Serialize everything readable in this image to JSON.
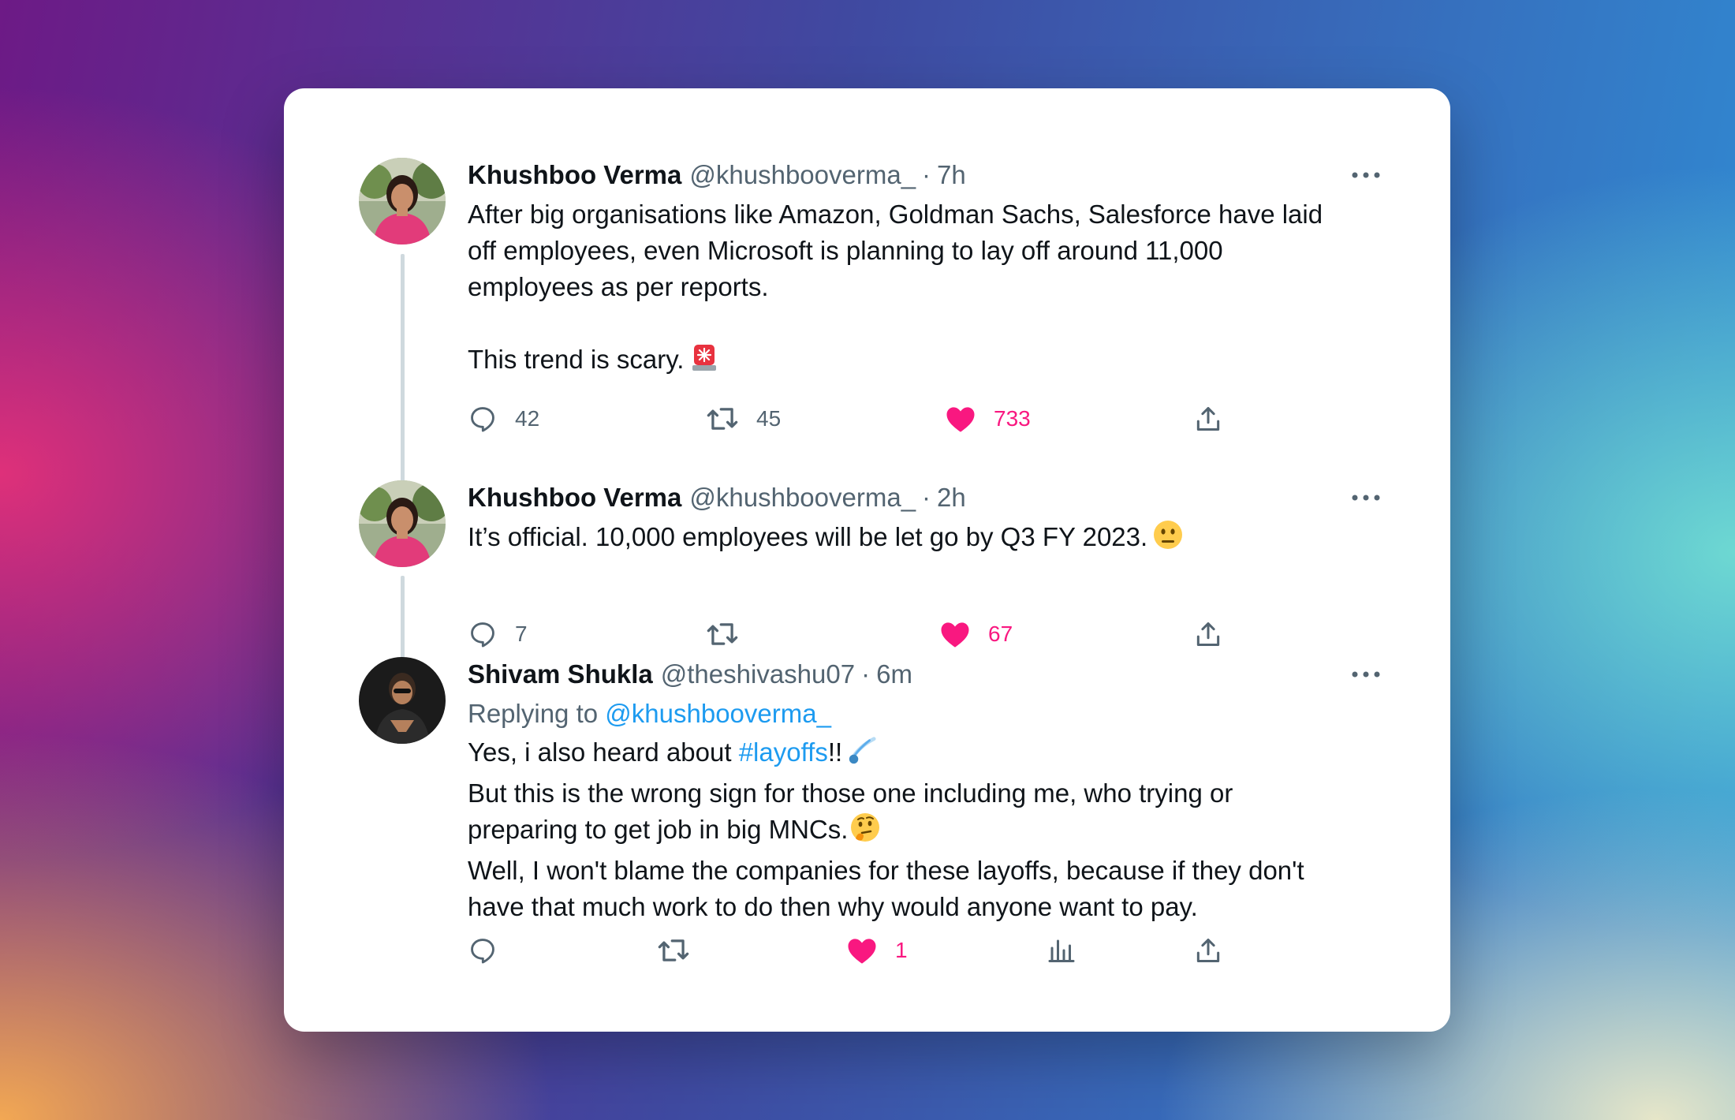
{
  "tweets": [
    {
      "name": "Khushboo Verma",
      "handle": "@khushbooverma_",
      "separator": "·",
      "time": "7h",
      "text_lines": [
        "After big organisations like Amazon, Goldman Sachs, Salesforce have laid",
        "off employees, even Microsoft is planning to lay off around 11,000",
        "employees as per reports."
      ],
      "text_line2": "This trend is scary.",
      "emoji": "police-light",
      "replies": "42",
      "retweets": "45",
      "likes": "733"
    },
    {
      "name": "Khushboo Verma",
      "handle": "@khushbooverma_",
      "separator": "·",
      "time": "2h",
      "text": "It’s official. 10,000 employees will be let go by Q3 FY 2023.",
      "emoji": "neutral-face",
      "replies": "7",
      "retweets": "",
      "likes": "67"
    },
    {
      "name": "Shivam Shukla",
      "handle": "@theshivashu07",
      "separator": "·",
      "time": "6m",
      "replying_to_label": "Replying to",
      "replying_to_handle": "@khushbooverma_",
      "line1_before": "Yes, i also heard about ",
      "line1_hashtag": "#layoffs",
      "line1_after": "!!",
      "line2": "But this is the wrong sign for those one including me, who trying or",
      "line3": "preparing to get job in big MNCs.",
      "line4": "Well, I won't blame the companies for these layoffs, because if they don't",
      "line5": "have that much work to do then why would anyone want to pay.",
      "replies": "",
      "retweets": "",
      "likes": "1"
    }
  ],
  "colors": {
    "like": "#f91880",
    "link": "#1d9bf0",
    "muted": "#536471",
    "text": "#0f1419",
    "thread_line": "#cfd9de"
  },
  "icons": [
    "reply-icon",
    "retweet-icon",
    "like-icon",
    "views-icon",
    "share-icon",
    "more-icon"
  ]
}
